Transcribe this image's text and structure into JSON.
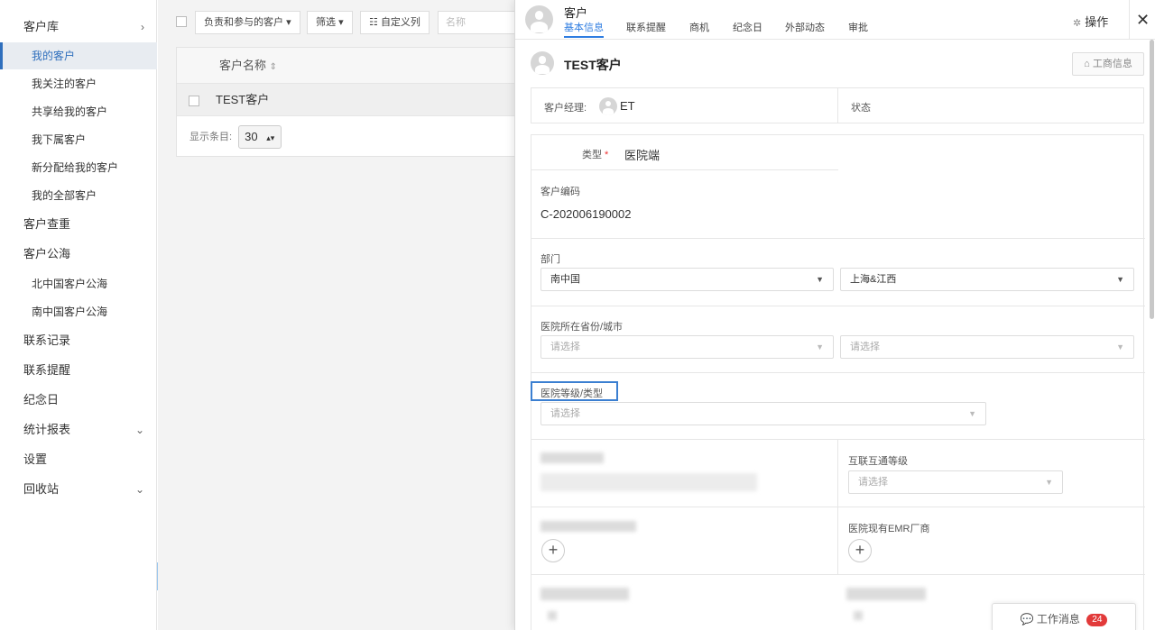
{
  "sidebar": {
    "items": [
      {
        "label": "客户库"
      },
      {
        "label": "我的客户"
      },
      {
        "label": "我关注的客户"
      },
      {
        "label": "共享给我的客户"
      },
      {
        "label": "我下属客户"
      },
      {
        "label": "新分配给我的客户"
      },
      {
        "label": "我的全部客户"
      },
      {
        "label": "客户查重"
      },
      {
        "label": "客户公海"
      },
      {
        "label": "北中国客户公海"
      },
      {
        "label": "南中国客户公海"
      },
      {
        "label": "联系记录"
      },
      {
        "label": "联系提醒"
      },
      {
        "label": "纪念日"
      },
      {
        "label": "统计报表"
      },
      {
        "label": "设置"
      },
      {
        "label": "回收站"
      }
    ]
  },
  "list": {
    "filter_owner": "负责和参与的客户",
    "filter_btn": "筛选",
    "custom_cols": "自定义列",
    "search_placeholder": "名称",
    "header_name": "客户名称",
    "sort_icon": "⇕",
    "rows": [
      {
        "name": "TEST客户"
      }
    ],
    "page_size_label": "显示条目:",
    "page_size": "30"
  },
  "panel": {
    "entity": "客户",
    "tabs": [
      "基本信息",
      "联系提醒",
      "商机",
      "纪念日",
      "外部动态",
      "审批"
    ],
    "actions_label": "操作",
    "customer_name": "TEST客户",
    "biz_info_btn": "工商信息",
    "manager_label": "客户经理:",
    "manager_name": "ET",
    "status_label": "状态",
    "type_label": "类型",
    "type_value": "医院端",
    "code_label": "客户编码",
    "code_value": "C-202006190002",
    "dept_label": "部门",
    "dept_value_1": "南中国",
    "dept_value_2": "上海&江西",
    "province_label": "医院所在省份/城市",
    "please_select": "请选择",
    "grade_label": "医院等级/类型",
    "interop_label": "互联互通等级",
    "emr_label": "医院现有EMR厂商"
  },
  "message_bar": {
    "label": "工作消息",
    "count": "24"
  },
  "colors": {
    "accent": "#2f7de1",
    "active_bg": "#e8ecf1",
    "badge": "#e23a3a"
  }
}
